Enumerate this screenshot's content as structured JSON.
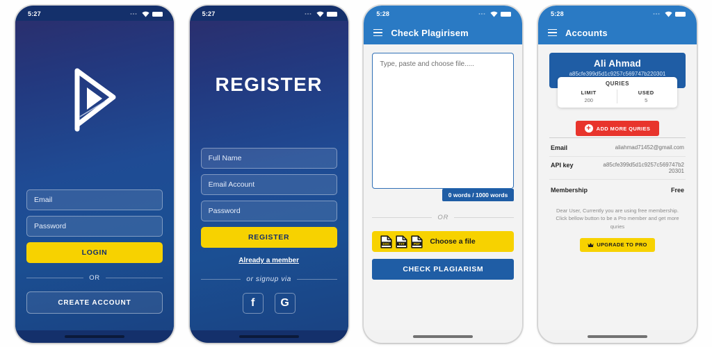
{
  "screens": {
    "login": {
      "status_time": "5:27",
      "logo_icon": "play-triangle-logo",
      "email_placeholder": "Email",
      "password_placeholder": "Password",
      "login_button": "LOGIN",
      "divider": "OR",
      "create_account_button": "CREATE ACCOUNT"
    },
    "register": {
      "status_time": "5:27",
      "title": "REGISTER",
      "fullname_placeholder": "Full Name",
      "email_placeholder": "Email Account",
      "password_placeholder": "Password",
      "register_button": "REGISTER",
      "member_link": "Already a member",
      "divider": "or signup via",
      "social": [
        {
          "name": "facebook-icon",
          "glyph": "f"
        },
        {
          "name": "google-icon",
          "glyph": "G"
        }
      ]
    },
    "plagiarism": {
      "status_time": "5:28",
      "title": "Check Plagirisem",
      "menu_icon": "hamburger-icon",
      "textarea_placeholder": "Type, paste and choose file.....",
      "word_count": "0 words / 1000 words",
      "divider": "OR",
      "choose_file_button": "Choose a file",
      "file_icons": [
        "doc-file-icon",
        "txt-file-icon",
        "pdf-file-icon"
      ],
      "file_icon_labels": [
        "DOC",
        "TXT",
        "PDF"
      ],
      "check_button": "CHECK PLAGIARISM"
    },
    "accounts": {
      "status_time": "5:28",
      "title": "Accounts",
      "menu_icon": "hamburger-icon",
      "user_name": "Ali Ahmad",
      "user_key": "a85cfe399d5d1c9257c569747b220301",
      "quries_title": "QURIES",
      "quries": [
        {
          "label": "LIMIT",
          "value": "200"
        },
        {
          "label": "USED",
          "value": "5"
        }
      ],
      "add_quries_button": "ADD MORE QURIES",
      "rows": [
        {
          "label": "Email",
          "value": "aliahmad71452@gmail.com"
        },
        {
          "label": "API key",
          "value": "a85cfe399d5d1c9257c569747b220301"
        }
      ],
      "membership_label": "Membership",
      "membership_value": "Free",
      "notice": "Dear User, Currently you are using free membership. Click bellow button to be a Pro member and get more quries",
      "upgrade_button": "UPGRADE TO PRO",
      "crown_icon": "crown-icon"
    }
  },
  "colors": {
    "brand_navy": "#1f4b94",
    "brand_yellow": "#f7d200",
    "app_blue": "#2a7ac4",
    "primary_blue": "#1f5da5",
    "danger_red": "#e8342c",
    "light_bg": "#f3f3f3"
  }
}
